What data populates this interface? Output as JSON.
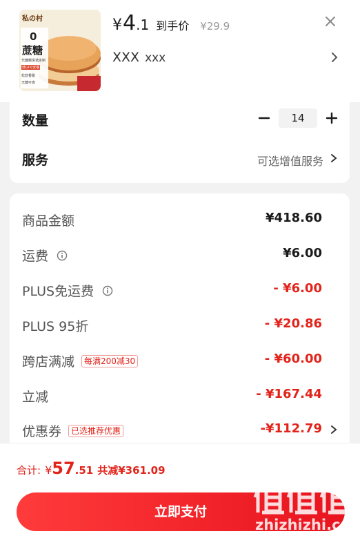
{
  "product": {
    "price_symbol": "¥",
    "price_integer": "4",
    "price_decimal": ".1",
    "price_tag": "到手价",
    "original_price": "¥29.9",
    "spec_main": "XXX",
    "spec_sub": "xxx",
    "thumbnail_brand": "私の村",
    "thumbnail_zero": "0",
    "thumbnail_title": "蔗糖",
    "thumbnail_line1": "代糖糕饼诺定制",
    "thumbnail_line2": "低GI可安嚼",
    "thumbnail_line3": "松软香甜",
    "thumbnail_line4": "无糖可食"
  },
  "quantity": {
    "label": "数量",
    "value": "14"
  },
  "service": {
    "label": "服务",
    "value": "可选增值服务"
  },
  "breakdown": [
    {
      "label": "商品金额",
      "value": "¥418.60",
      "red": false,
      "info": false,
      "tag": "",
      "arrow": false
    },
    {
      "label": "运费",
      "value": "¥6.00",
      "red": false,
      "info": true,
      "tag": "",
      "arrow": false
    },
    {
      "label": "PLUS免运费",
      "value": "- ¥6.00",
      "red": true,
      "info": true,
      "tag": "",
      "arrow": false
    },
    {
      "label": "PLUS 95折",
      "value": "- ¥20.86",
      "red": true,
      "info": false,
      "tag": "",
      "arrow": false
    },
    {
      "label": "跨店满减",
      "value": "- ¥60.00",
      "red": true,
      "info": false,
      "tag": "每满200减30",
      "arrow": false
    },
    {
      "label": "立减",
      "value": "- ¥167.44",
      "red": true,
      "info": false,
      "tag": "",
      "arrow": false
    },
    {
      "label": "优惠券",
      "value": "-¥112.79",
      "red": true,
      "info": false,
      "tag": "已选推荐优惠",
      "arrow": true
    }
  ],
  "footer": {
    "total_label": "合计:",
    "total_symbol": "¥",
    "total_integer": "57",
    "total_decimal": ".51",
    "savings": "共减¥361.09",
    "pay_button": "立即支付"
  },
  "watermark": {
    "text": "zhizhizhi.com",
    "logo": "值值值"
  },
  "colors": {
    "accent_red": "#e2231a",
    "pay_gradient_start": "#ff3b3b",
    "pay_gradient_end": "#e8131e"
  }
}
